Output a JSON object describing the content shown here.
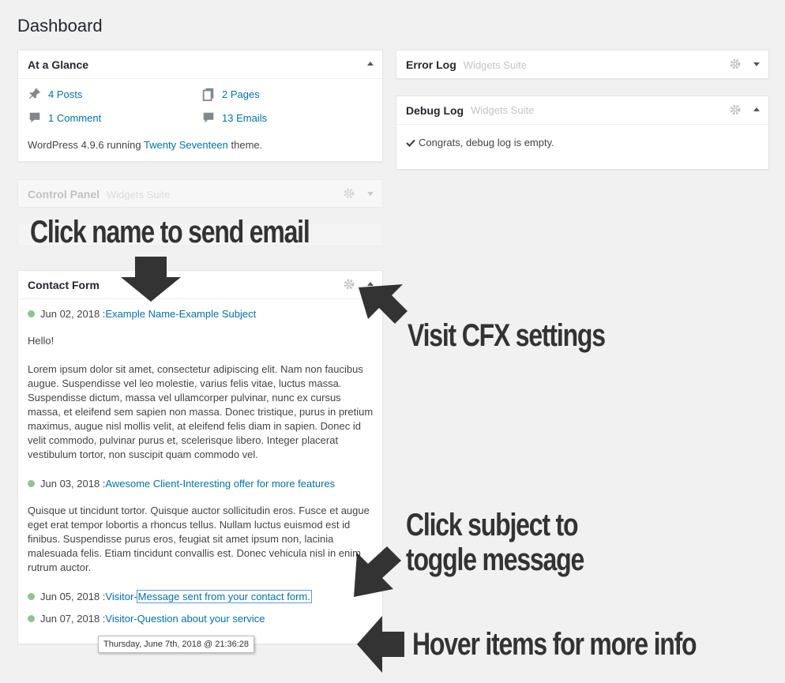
{
  "page": {
    "title": "Dashboard"
  },
  "at_a_glance": {
    "title": "At a Glance",
    "items": [
      {
        "label": "4 Posts",
        "icon": "pushpin-icon"
      },
      {
        "label": "2 Pages",
        "icon": "pages-icon"
      },
      {
        "label": "1 Comment",
        "icon": "comment-icon"
      },
      {
        "label": "13 Emails",
        "icon": "comment-icon"
      }
    ],
    "footer_prefix": "WordPress 4.9.6 running ",
    "theme_link": "Twenty Seventeen",
    "footer_suffix": " theme."
  },
  "control_panel": {
    "title": "Control Panel",
    "subtitle": "Widgets Suite"
  },
  "error_log": {
    "title": "Error Log",
    "subtitle": "Widgets Suite"
  },
  "debug_log": {
    "title": "Debug Log",
    "subtitle": "Widgets Suite",
    "message": "Congrats, debug log is empty."
  },
  "contact_form": {
    "title": "Contact Form",
    "sep": " - ",
    "messages": [
      {
        "date": "Jun 02, 2018 : ",
        "name": "Example Name",
        "subject": "Example Subject"
      },
      {
        "date": "Jun 03, 2018 : ",
        "name": "Awesome Client",
        "subject": "Interesting offer for more features"
      },
      {
        "date": "Jun 05, 2018 : ",
        "name": "Visitor",
        "subject": "Message sent from your contact form."
      },
      {
        "date": "Jun 07, 2018 : ",
        "name": "Visitor",
        "subject": "Question about your service"
      }
    ],
    "message1_greeting": "Hello!",
    "message1_body": "Lorem ipsum dolor sit amet, consectetur adipiscing elit. Nam non faucibus augue. Suspendisse vel leo molestie, varius felis vitae, luctus massa. Suspendisse dictum, massa vel ullamcorper pulvinar, nunc ex cursus massa, et eleifend sem sapien non massa. Donec tristique, purus in pretium maximus, augue nisl mollis velit, at eleifend felis diam in sapien. Donec id velit commodo, pulvinar purus et, scelerisque libero. Integer placerat vestibulum tortor, non suscipit quam commodo vel.",
    "message2_body": "Quisque ut tincidunt tortor. Quisque auctor sollicitudin eros. Fusce et augue eget erat tempor lobortis a rhoncus tellus. Nullam luctus euismod est id finibus. Suspendisse purus eros, feugiat sit amet ipsum non, lacinia malesuada felis. Etiam tincidunt convallis est. Donec vehicula nisl in enim rutrum auctor.",
    "tooltip": "Thursday, June 7th, 2018 @ 21:36:28"
  },
  "annotations": {
    "click_name": "Click name to send email",
    "visit_settings": "Visit CFX settings",
    "click_subject_1": "Click subject to",
    "click_subject_2": "toggle message",
    "hover_items": "Hover items for more info"
  },
  "colors": {
    "link": "#0073aa",
    "unread_dot": "#8cc68c",
    "annotation": "#333333"
  }
}
